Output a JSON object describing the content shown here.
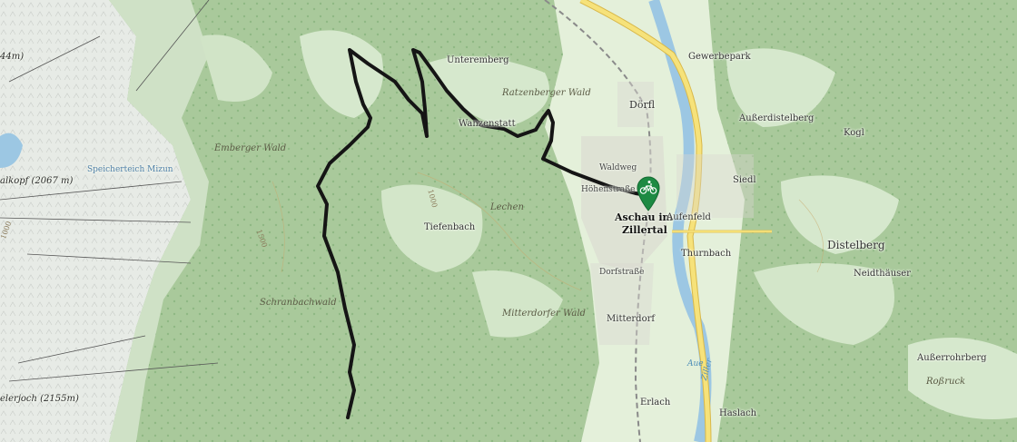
{
  "map": {
    "colors": {
      "forest": "#a8c99a",
      "forest_dark": "#7fab78",
      "meadow": "#d8ead0",
      "valley": "#e6f1dc",
      "river": "#9cc7e3",
      "road_main": "#f6e27a",
      "road_edge": "#d8b84a",
      "route": "#151515",
      "marker": "#1d8a43",
      "rock": "#e9ece8"
    },
    "labels": {
      "peak_1": "44m)",
      "peak_2": "alkopf (2067 m)",
      "peak_3": "elerjoch (2155m)",
      "speicherteich": "Speicherteich Mizun",
      "emberger_wald": "Emberger Wald",
      "unteremberg": "Unteremberg",
      "ratzenberger_wald": "Ratzenberger Wald",
      "wanzenstatt": "Wanzenstatt",
      "lechen": "Lechen",
      "tiefenbach": "Tiefenbach",
      "schranbachwald": "Schranbachwald",
      "mitterdorfer_wald": "Mitterdorfer Wald",
      "doerfl": "Dörfl",
      "waldweg": "Waldweg",
      "hoehenstrasse": "Höhenstraße",
      "aschau_line1": "Aschau im",
      "aschau_line2": "Zillertal",
      "dorfstrasse": "Dorfstraße",
      "mitterdorf": "Mitterdorf",
      "erlach": "Erlach",
      "aue": "Aue",
      "gewerbepark": "Gewerbepark",
      "ausserdistelberg": "Außerdistelberg",
      "kogl": "Kogl",
      "siedl": "Siedl",
      "aufenfeld": "Aufenfeld",
      "thurnbach": "Thurnbach",
      "distelberg": "Distelberg",
      "neidthaeuser": "Neidthäuser",
      "ausserrohrberg": "Außerrohrberg",
      "rossruck": "Roßruck",
      "haslach": "Haslach",
      "ziller": "Ziller",
      "contour_1000": "1000",
      "contour_1500": "1500",
      "contour_1000b": "1000"
    },
    "marker": {
      "icon": "mountain-bike-icon"
    }
  }
}
